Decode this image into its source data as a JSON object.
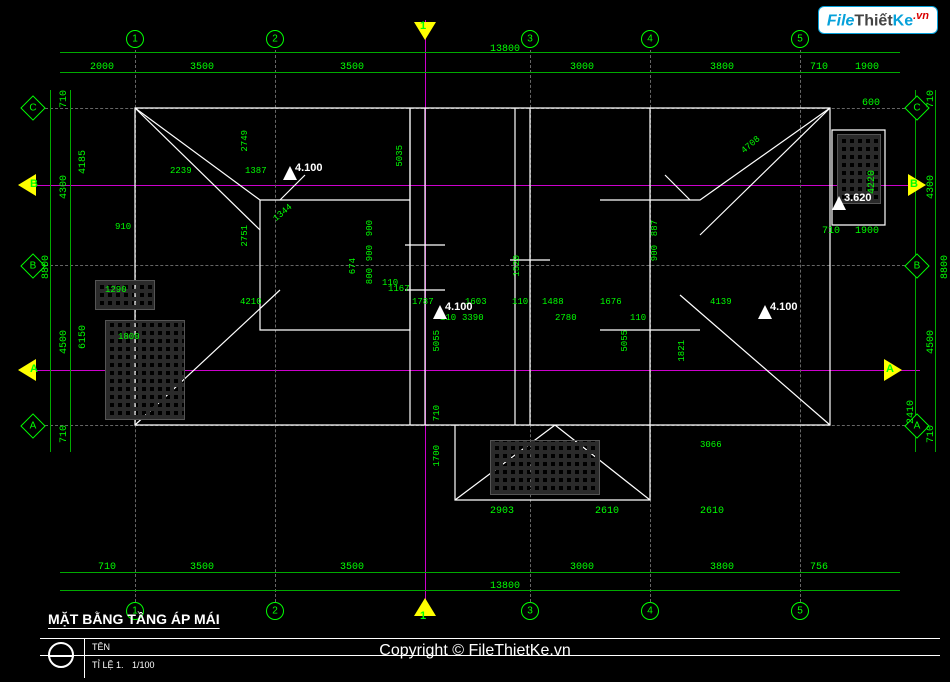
{
  "drawing_title": "MẶT BẰNG TẦNG ÁP MÁI",
  "title_block": {
    "label_name": "TÊN",
    "label_scale": "TỈ LỆ 1.",
    "scale": "1/100"
  },
  "watermark": {
    "logo_file": "File",
    "logo_thiet": "Thiết",
    "logo_ke": "Ke",
    "logo_vn": ".vn",
    "copyright": "Copyright © FileThietKe.vn"
  },
  "grid_axes": {
    "vertical": [
      "1",
      "2",
      "3",
      "4",
      "5"
    ],
    "horizontal": [
      "A",
      "B",
      "C"
    ]
  },
  "section_marks": {
    "A": "A",
    "B": "B",
    "one": "1"
  },
  "elevations": {
    "e1": "4.100",
    "e2": "4.100",
    "e3": "4.100",
    "e4": "3.620"
  },
  "dims_top": {
    "d1": "2000",
    "d2": "3500",
    "d3": "3500",
    "d4": "3000",
    "d5": "3800",
    "d6": "710",
    "d7": "1900",
    "overall": "13800"
  },
  "dims_bottom": {
    "d0": "710",
    "d1": "3500",
    "d2": "3500",
    "d3": "3000",
    "d4": "3800",
    "d5": "756",
    "overall": "13800",
    "d6": "2903",
    "d7": "2610",
    "d8": "2610"
  },
  "dims_left": {
    "d1": "710",
    "d2": "4300",
    "d3": "4500",
    "d4": "710",
    "overall": "8800",
    "d5": "4185",
    "d6": "6150"
  },
  "dims_right": {
    "d1": "710",
    "d2": "4300",
    "d3": "4500",
    "d4": "710",
    "overall": "8800",
    "d5": "2410",
    "d6": "4220",
    "d7": "600",
    "d8": "1900",
    "d9": "710"
  },
  "dims_internal": {
    "i1": "2239",
    "i2": "1387",
    "i3": "910",
    "i4": "1290",
    "i5": "1800",
    "i6": "4210",
    "i7": "1787",
    "i8": "1603",
    "i9": "1488",
    "i10": "1676",
    "i11": "4139",
    "i12": "3390",
    "i13": "110",
    "i14": "2780",
    "i15": "1344",
    "i16": "2751",
    "i17": "2749",
    "i18": "4708",
    "i19": "110",
    "i20": "1520",
    "i21": "5055",
    "i22": "5055",
    "i23": "900",
    "i24": "900",
    "i25": "800",
    "i26": "110",
    "i27": "674",
    "i28": "110",
    "i29": "3066",
    "i30": "1821",
    "i31": "1700",
    "i32": "710",
    "i33": "887",
    "i34": "900",
    "i35": "1167",
    "i36": "5035"
  }
}
